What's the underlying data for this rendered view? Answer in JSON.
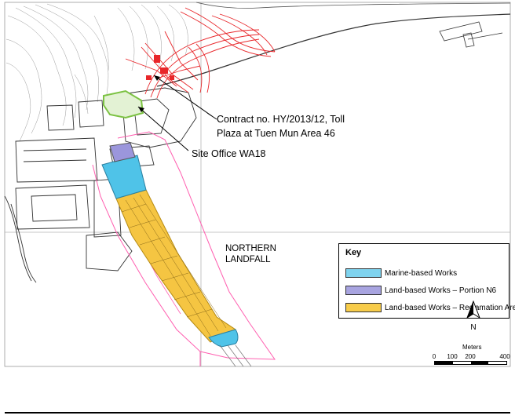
{
  "callouts": {
    "contract_line1": "Contract no. HY/2013/12, Toll",
    "contract_line2": "Plaza at Tuen Mun Area 46",
    "site_office": "Site Office WA18"
  },
  "area_label": {
    "line1": "NORTHERN",
    "line2": "LANDFALL"
  },
  "key": {
    "title": "Key",
    "items": [
      {
        "label": "Marine-based Works",
        "color": "#7fd3ee"
      },
      {
        "label": "Land-based  Works – Portion N6",
        "color": "#a8a4e0"
      },
      {
        "label": "Land-based  Works – Reclamation Area",
        "color": "#f7cc4a"
      }
    ]
  },
  "north_arrow": {
    "letter": "N"
  },
  "scale_bar": {
    "title": "Meters",
    "ticks": [
      "0",
      "100",
      "200",
      "400"
    ]
  },
  "colors": {
    "reclamation_fill": "#f5c542",
    "marine_fill": "#4fc3e8",
    "portion_n6_fill": "#9b96dc",
    "site_office_outline": "#7cc243",
    "works_boundary": "#ff5fb0",
    "toll_plaza_lines": "#e8262a"
  }
}
